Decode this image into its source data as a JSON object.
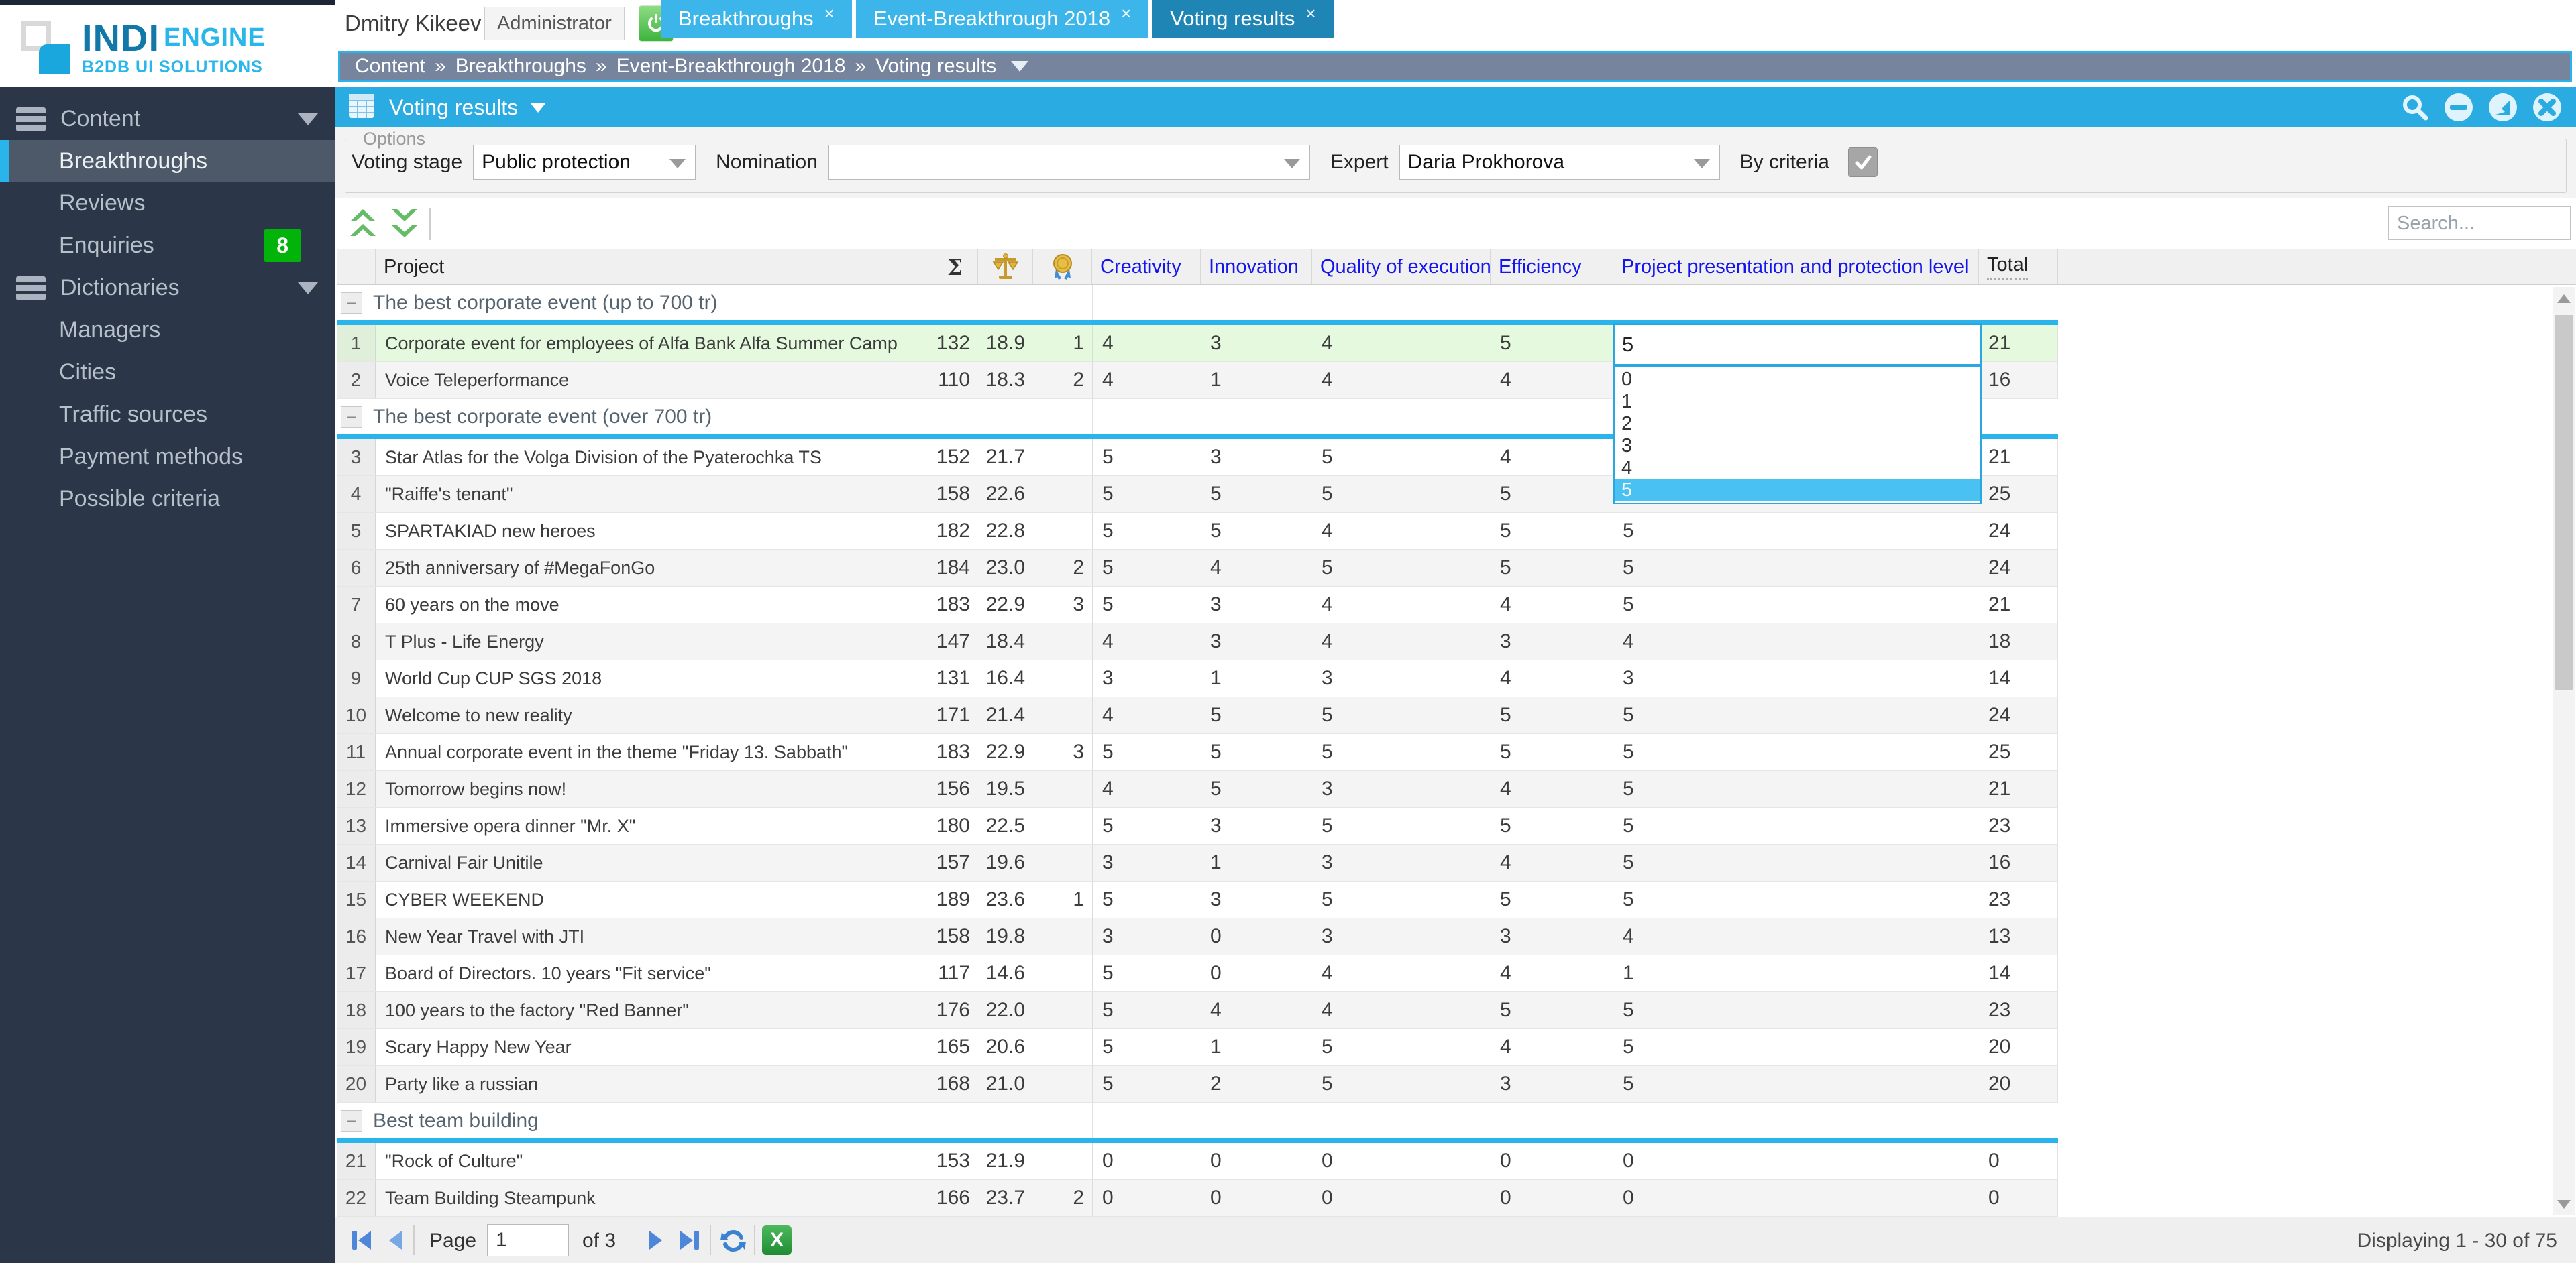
{
  "logo": {
    "title": "INDI",
    "title2": "ENGINE",
    "subtitle": "B2DB UI SOLUTIONS"
  },
  "header": {
    "user_name": "Dmitry Kikeev",
    "role_badge": "Administrator",
    "tabs": [
      {
        "label": "Breakthroughs",
        "active": false
      },
      {
        "label": "Event-Breakthrough 2018",
        "active": false
      },
      {
        "label": "Voting results",
        "active": true
      }
    ]
  },
  "breadcrumb": {
    "separator": "»",
    "items": [
      "Content",
      "Breakthroughs",
      "Event-Breakthrough 2018",
      "Voting results"
    ]
  },
  "sidebar": {
    "items": [
      {
        "label": "Content",
        "section": true
      },
      {
        "label": "Breakthroughs",
        "selected": true
      },
      {
        "label": "Reviews"
      },
      {
        "label": "Enquiries",
        "badge": "8"
      },
      {
        "label": "Dictionaries",
        "section": true
      },
      {
        "label": "Managers"
      },
      {
        "label": "Cities"
      },
      {
        "label": "Traffic sources"
      },
      {
        "label": "Payment methods"
      },
      {
        "label": "Possible criteria"
      }
    ]
  },
  "panel": {
    "title": "Voting results"
  },
  "options": {
    "legend": "Options",
    "voting_stage_label": "Voting stage",
    "voting_stage_value": "Public protection",
    "nomination_label": "Nomination",
    "nomination_value": "",
    "expert_label": "Expert",
    "expert_value": "Daria Prokhorova",
    "by_criteria_label": "By criteria",
    "by_criteria_checked": true
  },
  "toolbar": {
    "search_placeholder": "Search..."
  },
  "icons": {
    "close_glyph": "×",
    "collapse_glyph": "−",
    "excel_glyph": "X",
    "titlebar_icons": [
      "search-icon",
      "collapse-panel-icon",
      "restore-panel-icon",
      "close-panel-icon"
    ],
    "header_icons": [
      "sum-sigma",
      "scales-icon",
      "medal-icon"
    ]
  },
  "table": {
    "header": {
      "project": "Project",
      "sum": "Σ",
      "criteria": [
        "Creativity",
        "Innovation",
        "Quality of execution",
        "Efficiency",
        "Project presentation and protection level"
      ],
      "total": "Total"
    },
    "groups": [
      {
        "label": "The best corporate event (up to 700 tr)",
        "rows": [
          {
            "num": 1,
            "project": "Corporate event for employees of Alfa Bank Alfa Summer Camp",
            "sum": "132",
            "weight": "18.9",
            "medal": "1",
            "scores": [
              "4",
              "3",
              "4",
              "5",
              null
            ],
            "total": "21",
            "highlight": true,
            "editor_open": true
          },
          {
            "num": 2,
            "project": "Voice Teleperformance",
            "sum": "110",
            "weight": "18.3",
            "medal": "2",
            "scores": [
              "4",
              "1",
              "4",
              "4",
              null
            ],
            "total": "16"
          }
        ]
      },
      {
        "label": "The best corporate event (over 700 tr)",
        "rows": [
          {
            "num": 3,
            "project": "Star Atlas for the Volga Division of the Pyaterochka TS",
            "sum": "152",
            "weight": "21.7",
            "medal": "",
            "scores": [
              "5",
              "3",
              "5",
              "4",
              null
            ],
            "total": "21"
          },
          {
            "num": 4,
            "project": "\"Raiffe's tenant\"",
            "sum": "158",
            "weight": "22.6",
            "medal": "",
            "scores": [
              "5",
              "5",
              "5",
              "5",
              null
            ],
            "total": "25"
          },
          {
            "num": 5,
            "project": "SPARTAKIAD new heroes",
            "sum": "182",
            "weight": "22.8",
            "medal": "",
            "scores": [
              "5",
              "5",
              "4",
              "5",
              "5"
            ],
            "total": "24"
          },
          {
            "num": 6,
            "project": "25th anniversary of #MegaFonGo",
            "sum": "184",
            "weight": "23.0",
            "medal": "2",
            "scores": [
              "5",
              "4",
              "5",
              "5",
              "5"
            ],
            "total": "24"
          },
          {
            "num": 7,
            "project": "60 years on the move",
            "sum": "183",
            "weight": "22.9",
            "medal": "3",
            "scores": [
              "5",
              "3",
              "4",
              "4",
              "5"
            ],
            "total": "21"
          },
          {
            "num": 8,
            "project": "T Plus - Life Energy",
            "sum": "147",
            "weight": "18.4",
            "medal": "",
            "scores": [
              "4",
              "3",
              "4",
              "3",
              "4"
            ],
            "total": "18"
          },
          {
            "num": 9,
            "project": "World Cup CUP SGS 2018",
            "sum": "131",
            "weight": "16.4",
            "medal": "",
            "scores": [
              "3",
              "1",
              "3",
              "4",
              "3"
            ],
            "total": "14"
          },
          {
            "num": 10,
            "project": "Welcome to new reality",
            "sum": "171",
            "weight": "21.4",
            "medal": "",
            "scores": [
              "4",
              "5",
              "5",
              "5",
              "5"
            ],
            "total": "24"
          },
          {
            "num": 11,
            "project": "Annual corporate event in the theme \"Friday 13. Sabbath\"",
            "sum": "183",
            "weight": "22.9",
            "medal": "3",
            "scores": [
              "5",
              "5",
              "5",
              "5",
              "5"
            ],
            "total": "25"
          },
          {
            "num": 12,
            "project": "Tomorrow begins now!",
            "sum": "156",
            "weight": "19.5",
            "medal": "",
            "scores": [
              "4",
              "5",
              "3",
              "4",
              "5"
            ],
            "total": "21"
          },
          {
            "num": 13,
            "project": "Immersive opera dinner \"Mr. X\"",
            "sum": "180",
            "weight": "22.5",
            "medal": "",
            "scores": [
              "5",
              "3",
              "5",
              "5",
              "5"
            ],
            "total": "23"
          },
          {
            "num": 14,
            "project": "Carnival Fair Unitile",
            "sum": "157",
            "weight": "19.6",
            "medal": "",
            "scores": [
              "3",
              "1",
              "3",
              "4",
              "5"
            ],
            "total": "16"
          },
          {
            "num": 15,
            "project": "CYBER WEEKEND",
            "sum": "189",
            "weight": "23.6",
            "medal": "1",
            "scores": [
              "5",
              "3",
              "5",
              "5",
              "5"
            ],
            "total": "23"
          },
          {
            "num": 16,
            "project": "New Year Travel with JTI",
            "sum": "158",
            "weight": "19.8",
            "medal": "",
            "scores": [
              "3",
              "0",
              "3",
              "3",
              "4"
            ],
            "total": "13"
          },
          {
            "num": 17,
            "project": "Board of Directors. 10 years \"Fit service\"",
            "sum": "117",
            "weight": "14.6",
            "medal": "",
            "scores": [
              "5",
              "0",
              "4",
              "4",
              "1"
            ],
            "total": "14"
          },
          {
            "num": 18,
            "project": "100 years to the factory \"Red Banner\"",
            "sum": "176",
            "weight": "22.0",
            "medal": "",
            "scores": [
              "5",
              "4",
              "4",
              "5",
              "5"
            ],
            "total": "23"
          },
          {
            "num": 19,
            "project": "Scary Happy New Year",
            "sum": "165",
            "weight": "20.6",
            "medal": "",
            "scores": [
              "5",
              "1",
              "5",
              "4",
              "5"
            ],
            "total": "20"
          },
          {
            "num": 20,
            "project": "Party like a russian",
            "sum": "168",
            "weight": "21.0",
            "medal": "",
            "scores": [
              "5",
              "2",
              "5",
              "3",
              "5"
            ],
            "total": "20"
          }
        ]
      },
      {
        "label": "Best team building",
        "rows": [
          {
            "num": 21,
            "project": "\"Rock of Culture\"",
            "sum": "153",
            "weight": "21.9",
            "medal": "",
            "scores": [
              "0",
              "0",
              "0",
              "0",
              "0"
            ],
            "total": "0"
          },
          {
            "num": 22,
            "project": "Team Building Steampunk",
            "sum": "166",
            "weight": "23.7",
            "medal": "2",
            "scores": [
              "0",
              "0",
              "0",
              "0",
              "0"
            ],
            "total": "0"
          }
        ]
      }
    ]
  },
  "editor": {
    "value": "5",
    "options": [
      "0",
      "1",
      "2",
      "3",
      "4",
      "5"
    ],
    "selected_index": 5
  },
  "pager": {
    "page_label": "Page",
    "page_value": "1",
    "of_label": "of 3",
    "displaying": "Displaying 1 - 30 of 75"
  }
}
